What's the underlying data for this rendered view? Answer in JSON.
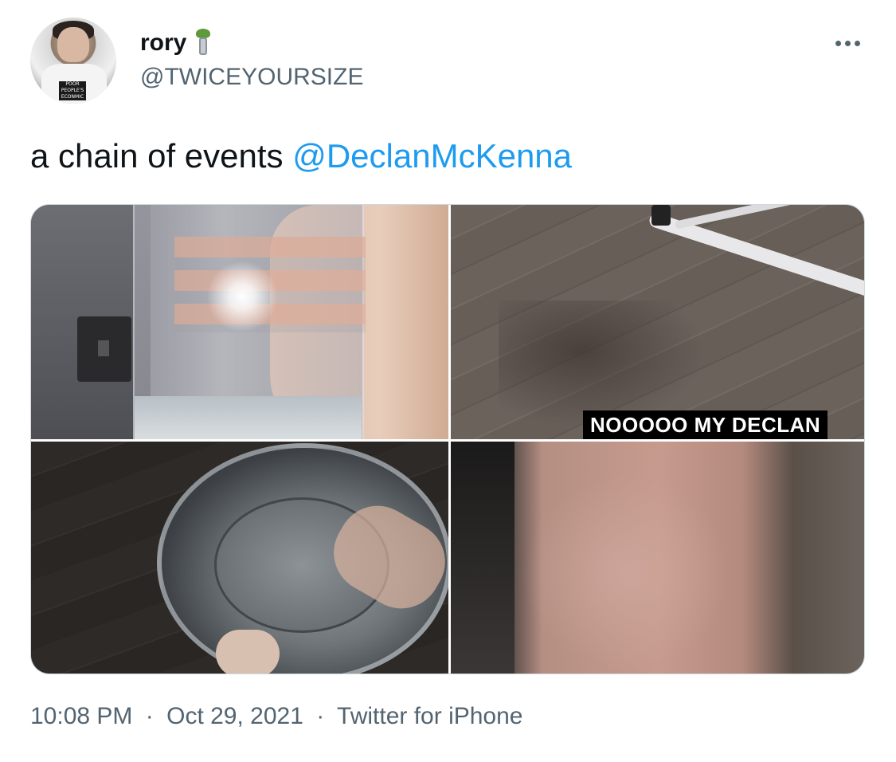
{
  "author": {
    "display_name": "rory",
    "handle": "@TWICEYOURSIZE",
    "avatar_shirt_text": "POOR PEOPLE'S ECONOMIC",
    "name_emoji": "flagpole-icon"
  },
  "more_icon": "more-horizontal-icon",
  "tweet": {
    "text": "a chain of events",
    "mention": "@DeclanMcKenna"
  },
  "media": {
    "photo_caption": "NOOOOO MY DECLAN",
    "photos": [
      "hand-holding-cup",
      "spilled-water-on-floor",
      "empty-cup-from-above",
      "blurry-fabric"
    ]
  },
  "meta": {
    "time": "10:08 PM",
    "date": "Oct 29, 2021",
    "source": "Twitter for iPhone",
    "separator": "·"
  },
  "colors": {
    "text": "#0f1419",
    "secondary": "#536471",
    "link": "#1d9bf0"
  }
}
